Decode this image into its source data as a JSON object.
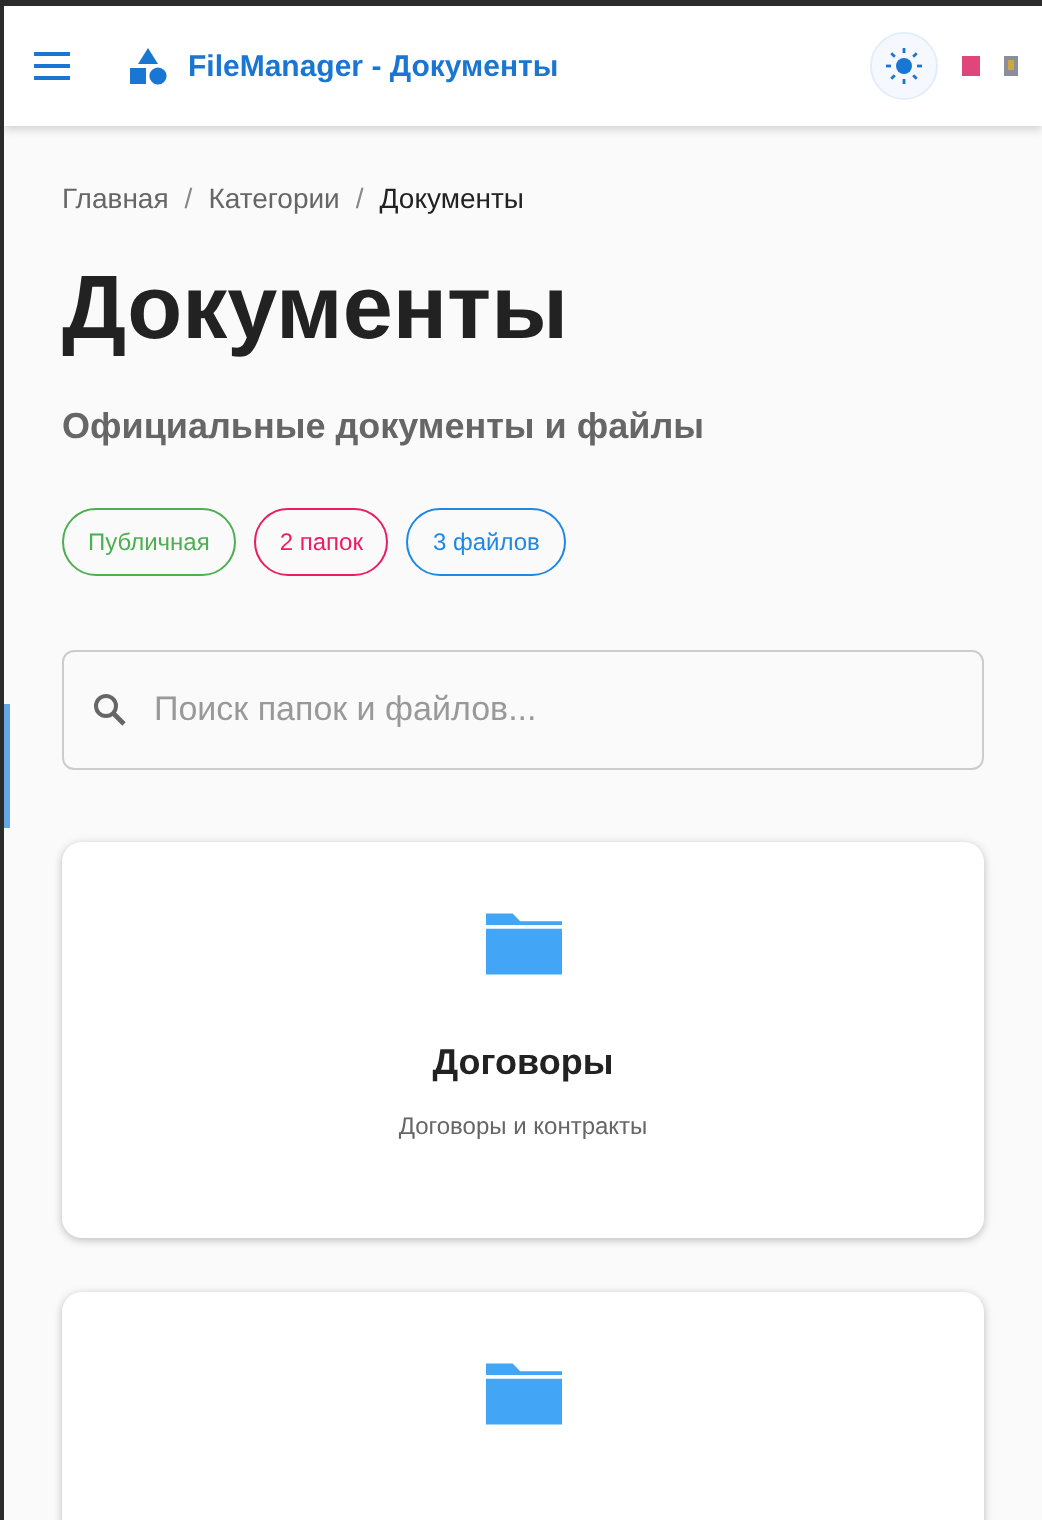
{
  "header": {
    "title": "FileManager - Документы"
  },
  "breadcrumbs": [
    {
      "label": "Главная",
      "current": false
    },
    {
      "label": "Категории",
      "current": false
    },
    {
      "label": "Документы",
      "current": true
    }
  ],
  "breadcrumb_separator": "/",
  "page": {
    "title": "Документы",
    "subtitle": "Официальные документы и файлы"
  },
  "tags": [
    {
      "label": "Публичная",
      "color": "#4caf50"
    },
    {
      "label": "2 папок",
      "color": "#e91e63"
    },
    {
      "label": "3 файлов",
      "color": "#1e88e5"
    }
  ],
  "search": {
    "placeholder": "Поиск папок и файлов..."
  },
  "folders": [
    {
      "kind": "full",
      "name": "Договоры",
      "description": "Договоры и контракты"
    },
    {
      "kind": "partial"
    }
  ]
}
